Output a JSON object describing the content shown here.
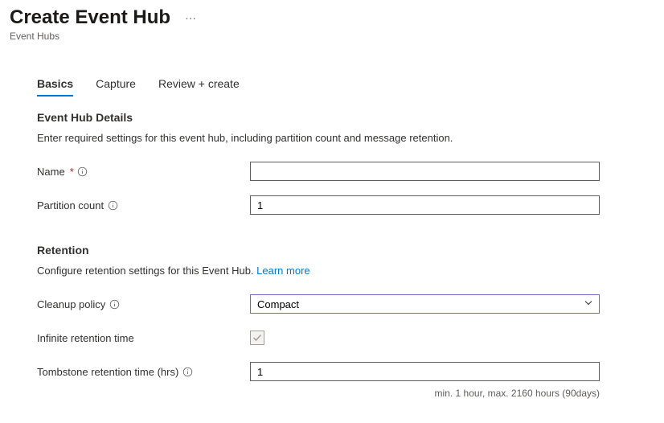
{
  "header": {
    "title": "Create Event Hub",
    "breadcrumb": "Event Hubs"
  },
  "tabs": [
    {
      "label": "Basics",
      "active": true
    },
    {
      "label": "Capture",
      "active": false
    },
    {
      "label": "Review + create",
      "active": false
    }
  ],
  "sections": {
    "details": {
      "title": "Event Hub Details",
      "description": "Enter required settings for this event hub, including partition count and message retention."
    },
    "retention": {
      "title": "Retention",
      "description_prefix": "Configure retention settings for this Event Hub. ",
      "learn_more": "Learn more"
    }
  },
  "fields": {
    "name": {
      "label": "Name",
      "required": true,
      "value": ""
    },
    "partition_count": {
      "label": "Partition count",
      "value": "1"
    },
    "cleanup_policy": {
      "label": "Cleanup policy",
      "value": "Compact"
    },
    "infinite_retention": {
      "label": "Infinite retention time",
      "checked": true,
      "disabled": true
    },
    "tombstone_retention": {
      "label": "Tombstone retention time (hrs)",
      "value": "1",
      "helper": "min. 1 hour, max. 2160 hours (90days)"
    }
  }
}
